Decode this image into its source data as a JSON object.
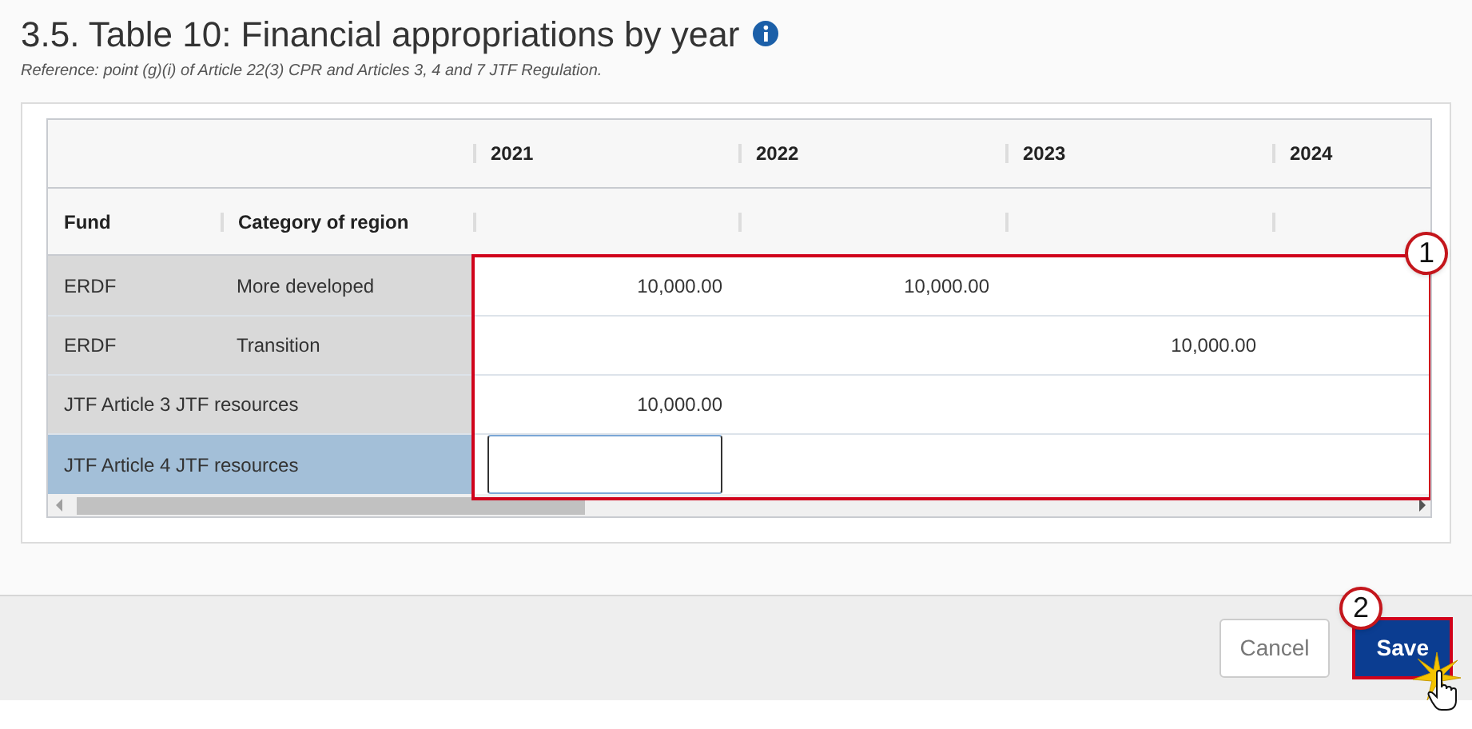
{
  "section": {
    "title": "3.5. Table 10: Financial appropriations by year",
    "reference": "Reference: point (g)(i) of Article 22(3) CPR and Articles 3, 4 and 7 JTF Regulation."
  },
  "table": {
    "years": [
      "2021",
      "2022",
      "2023",
      "2024"
    ],
    "columns": [
      "Fund",
      "Category of region"
    ],
    "rows": [
      {
        "fund": "ERDF",
        "category": "More developed",
        "selected": false,
        "cells": [
          {
            "kind": "text",
            "text": "10,000.00"
          },
          {
            "kind": "text",
            "text": "10,000.00"
          },
          {
            "kind": "empty"
          },
          {
            "kind": "empty"
          }
        ]
      },
      {
        "fund": "ERDF",
        "category": "Transition",
        "selected": false,
        "cells": [
          {
            "kind": "empty"
          },
          {
            "kind": "empty"
          },
          {
            "kind": "text",
            "text": "10,000.00"
          },
          {
            "kind": "empty"
          }
        ]
      },
      {
        "fund": "JTF Article 3 JTF resources",
        "selected": false,
        "cells": [
          {
            "kind": "text",
            "text": "10,000.00"
          },
          {
            "kind": "empty"
          },
          {
            "kind": "empty"
          },
          {
            "kind": "empty"
          }
        ]
      },
      {
        "fund": "JTF Article 4 JTF resources",
        "selected": true,
        "cells": [
          {
            "kind": "input"
          },
          {
            "kind": "empty"
          },
          {
            "kind": "empty"
          },
          {
            "kind": "empty"
          }
        ]
      }
    ]
  },
  "buttons": [
    {
      "label": "Cancel",
      "kind": "secondary"
    },
    {
      "label": "Save",
      "kind": "primary"
    }
  ],
  "callouts": [
    {
      "label": "1"
    },
    {
      "label": "2"
    }
  ]
}
